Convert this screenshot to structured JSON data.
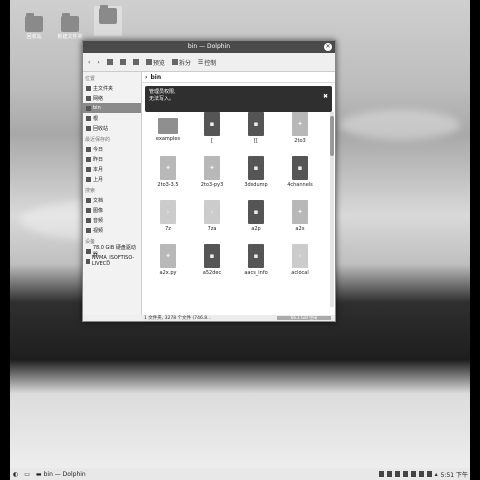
{
  "desktop": {
    "icons": [
      {
        "label": "回收站",
        "icon": "trash-folder-icon"
      },
      {
        "label": "新建文件夹",
        "icon": "folder-icon"
      },
      {
        "label": "",
        "icon": "home-folder-icon"
      }
    ]
  },
  "window": {
    "title": "bin — Dolphin",
    "toolbar": {
      "preview": "预览",
      "split": "拆分",
      "control": "控制"
    },
    "path": "bin",
    "notice": {
      "line1": "管理员权限,",
      "line2": "无法写入。"
    },
    "sidebar": {
      "sections": [
        {
          "heading": "位置",
          "items": [
            "主文件夹",
            "网络",
            "bin",
            "根",
            "回收站"
          ]
        },
        {
          "heading": "最近保存的",
          "items": [
            "今日",
            "昨日",
            "本月",
            "上月"
          ]
        },
        {
          "heading": "搜索",
          "items": [
            "文档",
            "图像",
            "音频",
            "视频"
          ]
        },
        {
          "heading": "设备",
          "items": [
            "78.0 GiB 硬盘驱动器",
            "NVMA_ISOFTISO-LIVECD"
          ]
        }
      ]
    },
    "files": [
      {
        "name": "examples",
        "type": "folder"
      },
      {
        "name": "[",
        "type": "exec"
      },
      {
        "name": "[[",
        "type": "exec"
      },
      {
        "name": "2to3",
        "type": "script"
      },
      {
        "name": "2to3-3.5",
        "type": "script"
      },
      {
        "name": "2to3-py3",
        "type": "script"
      },
      {
        "name": "3dsdump",
        "type": "exec"
      },
      {
        "name": "4channels",
        "type": "exec"
      },
      {
        "name": "7z",
        "type": "text"
      },
      {
        "name": "7za",
        "type": "text"
      },
      {
        "name": "a2p",
        "type": "exec"
      },
      {
        "name": "a2x",
        "type": "script"
      },
      {
        "name": "a2x.py",
        "type": "script"
      },
      {
        "name": "a52dec",
        "type": "exec"
      },
      {
        "name": "aacs_info",
        "type": "exec"
      },
      {
        "name": "aclocal",
        "type": "text"
      }
    ],
    "status": {
      "text": "1 文件夹, 3278 个文件 (746.8...",
      "free": "66.1 GiB 空闲"
    }
  },
  "taskbar": {
    "task_label": "bin — Dolphin",
    "clock": "5:51 下午"
  }
}
